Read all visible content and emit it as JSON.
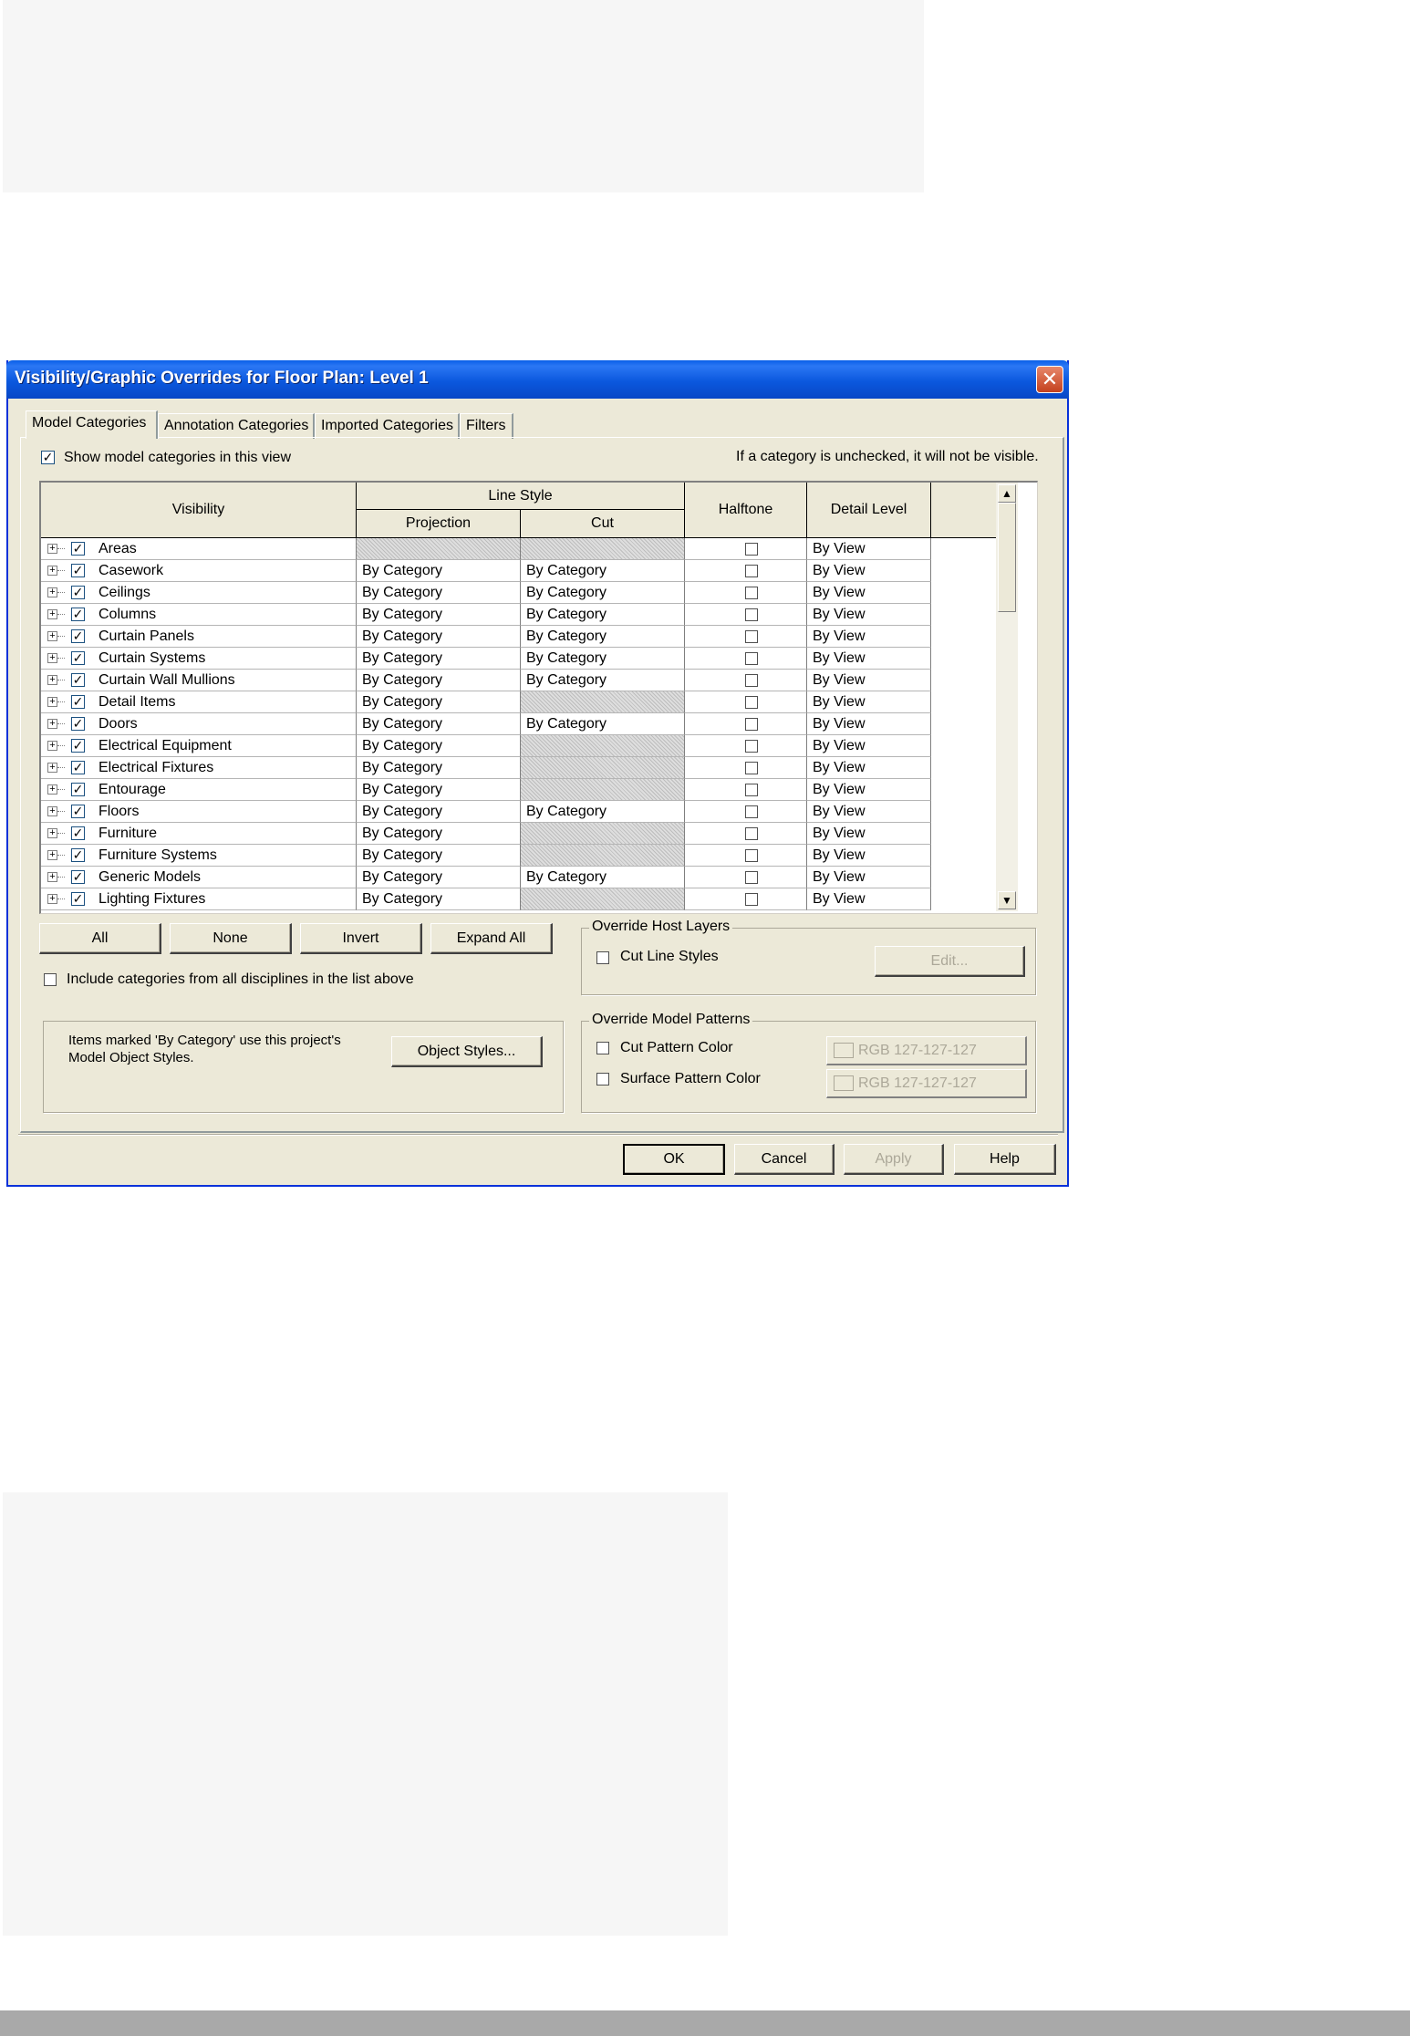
{
  "dialog": {
    "title": "Visibility/Graphic Overrides for Floor Plan: Level 1",
    "close_glyph": "✕",
    "tabs": [
      {
        "label": "Model Categories"
      },
      {
        "label": "Annotation Categories"
      },
      {
        "label": "Imported Categories"
      },
      {
        "label": "Filters"
      }
    ],
    "show_model_categories": {
      "label": "Show model categories in this view",
      "checked": true
    },
    "hint": "If a category is unchecked, it will not be visible.",
    "grid": {
      "headers": {
        "visibility": "Visibility",
        "line_style": "Line Style",
        "projection": "Projection",
        "cut": "Cut",
        "halftone": "Halftone",
        "detail_level": "Detail Level"
      },
      "rows": [
        {
          "name": "Areas",
          "projection": "",
          "cut": "",
          "detail": "By View",
          "proj_hatched": true,
          "cut_hatched": true
        },
        {
          "name": "Casework",
          "projection": "By Category",
          "cut": "By Category",
          "detail": "By View",
          "proj_hatched": false,
          "cut_hatched": false
        },
        {
          "name": "Ceilings",
          "projection": "By Category",
          "cut": "By Category",
          "detail": "By View",
          "proj_hatched": false,
          "cut_hatched": false
        },
        {
          "name": "Columns",
          "projection": "By Category",
          "cut": "By Category",
          "detail": "By View",
          "proj_hatched": false,
          "cut_hatched": false
        },
        {
          "name": "Curtain Panels",
          "projection": "By Category",
          "cut": "By Category",
          "detail": "By View",
          "proj_hatched": false,
          "cut_hatched": false
        },
        {
          "name": "Curtain Systems",
          "projection": "By Category",
          "cut": "By Category",
          "detail": "By View",
          "proj_hatched": false,
          "cut_hatched": false
        },
        {
          "name": "Curtain Wall Mullions",
          "projection": "By Category",
          "cut": "By Category",
          "detail": "By View",
          "proj_hatched": false,
          "cut_hatched": false
        },
        {
          "name": "Detail Items",
          "projection": "By Category",
          "cut": "",
          "detail": "By View",
          "proj_hatched": false,
          "cut_hatched": true
        },
        {
          "name": "Doors",
          "projection": "By Category",
          "cut": "By Category",
          "detail": "By View",
          "proj_hatched": false,
          "cut_hatched": false
        },
        {
          "name": "Electrical Equipment",
          "projection": "By Category",
          "cut": "",
          "detail": "By View",
          "proj_hatched": false,
          "cut_hatched": true
        },
        {
          "name": "Electrical Fixtures",
          "projection": "By Category",
          "cut": "",
          "detail": "By View",
          "proj_hatched": false,
          "cut_hatched": true
        },
        {
          "name": "Entourage",
          "projection": "By Category",
          "cut": "",
          "detail": "By View",
          "proj_hatched": false,
          "cut_hatched": true
        },
        {
          "name": "Floors",
          "projection": "By Category",
          "cut": "By Category",
          "detail": "By View",
          "proj_hatched": false,
          "cut_hatched": false
        },
        {
          "name": "Furniture",
          "projection": "By Category",
          "cut": "",
          "detail": "By View",
          "proj_hatched": false,
          "cut_hatched": true
        },
        {
          "name": "Furniture Systems",
          "projection": "By Category",
          "cut": "",
          "detail": "By View",
          "proj_hatched": false,
          "cut_hatched": true
        },
        {
          "name": "Generic Models",
          "projection": "By Category",
          "cut": "By Category",
          "detail": "By View",
          "proj_hatched": false,
          "cut_hatched": false
        },
        {
          "name": "Lighting Fixtures",
          "projection": "By Category",
          "cut": "",
          "detail": "By View",
          "proj_hatched": false,
          "cut_hatched": true
        }
      ]
    },
    "buttons": {
      "all": "All",
      "none": "None",
      "invert": "Invert",
      "expand_all": "Expand All",
      "object_styles": "Object Styles...",
      "edit": "Edit...",
      "ok": "OK",
      "cancel": "Cancel",
      "apply": "Apply",
      "help": "Help"
    },
    "include_disciplines": {
      "label": "Include categories from all disciplines in the list above",
      "checked": false
    },
    "info_text_1": "Items marked 'By Category' use this project's",
    "info_text_2": "Model Object Styles.",
    "override_host_layers": {
      "title": "Override Host Layers",
      "cut_line_styles": "Cut Line Styles"
    },
    "override_model_patterns": {
      "title": "Override Model Patterns",
      "cut_pattern_color": "Cut Pattern Color",
      "surface_pattern_color": "Surface Pattern Color",
      "cut_rgb": "RGB 127-127-127",
      "surface_rgb": "RGB 127-127-127"
    }
  }
}
